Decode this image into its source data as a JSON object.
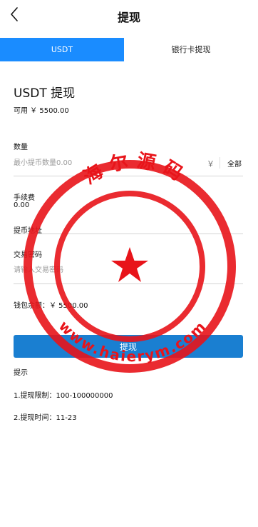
{
  "header": {
    "title": "提现"
  },
  "tabs": [
    {
      "label": "USDT",
      "active": true
    },
    {
      "label": "银行卡提现",
      "active": false
    }
  ],
  "section": {
    "title": "USDT 提现",
    "available": "可用 ￥ 5500.00"
  },
  "amount": {
    "label": "数量",
    "placeholder": "最小提币数量0.00",
    "currency": "￥",
    "all_label": "全部"
  },
  "fee": {
    "label": "手续费",
    "value": "0.00"
  },
  "address": {
    "label": "提币地址"
  },
  "password": {
    "label": "交易密码",
    "placeholder": "请输入交易密码"
  },
  "balance": {
    "text": "钱包余额：￥ 5500.00"
  },
  "submit_label": "提现",
  "tips": {
    "title": "提示",
    "items": [
      "1.提现限制：100-100000000",
      "2.提现时间：11-23"
    ]
  },
  "watermark": {
    "top_text": "海尔源码",
    "bottom_text": "www.haierym.com"
  },
  "colors": {
    "primary": "#1a8cff",
    "button": "#1a7fd1",
    "watermark": "#e8141a"
  }
}
